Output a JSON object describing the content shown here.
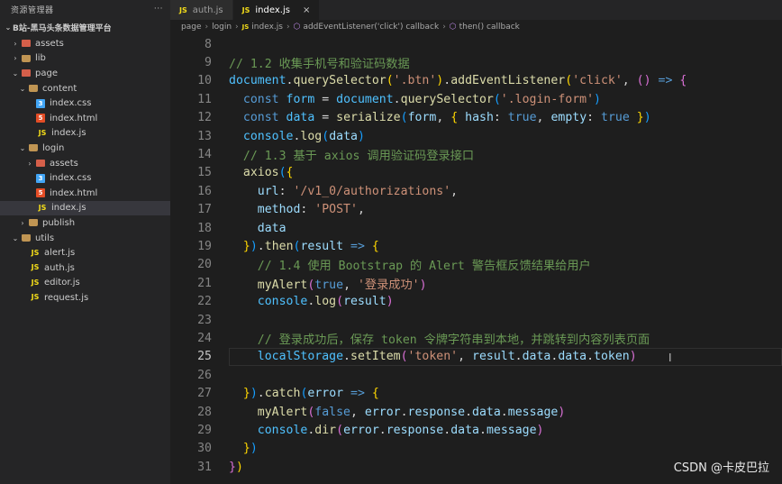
{
  "sidebar": {
    "header": "资源管理器",
    "root": "B站-黑马头条数据管理平台",
    "items": [
      {
        "label": "assets",
        "depth": 1,
        "kind": "folder-red",
        "chev": "›"
      },
      {
        "label": "lib",
        "depth": 1,
        "kind": "folder",
        "chev": "›"
      },
      {
        "label": "page",
        "depth": 1,
        "kind": "folder-red",
        "chev": "⌄"
      },
      {
        "label": "content",
        "depth": 2,
        "kind": "folder",
        "chev": "⌄"
      },
      {
        "label": "index.css",
        "depth": 3,
        "kind": "css",
        "chev": ""
      },
      {
        "label": "index.html",
        "depth": 3,
        "kind": "html",
        "chev": ""
      },
      {
        "label": "index.js",
        "depth": 3,
        "kind": "js",
        "chev": ""
      },
      {
        "label": "login",
        "depth": 2,
        "kind": "folder",
        "chev": "⌄"
      },
      {
        "label": "assets",
        "depth": 3,
        "kind": "folder-red",
        "chev": "›"
      },
      {
        "label": "index.css",
        "depth": 3,
        "kind": "css",
        "chev": ""
      },
      {
        "label": "index.html",
        "depth": 3,
        "kind": "html",
        "chev": ""
      },
      {
        "label": "index.js",
        "depth": 3,
        "kind": "js",
        "chev": "",
        "selected": true
      },
      {
        "label": "publish",
        "depth": 2,
        "kind": "folder",
        "chev": "›"
      },
      {
        "label": "utils",
        "depth": 1,
        "kind": "folder",
        "chev": "⌄"
      },
      {
        "label": "alert.js",
        "depth": 2,
        "kind": "js",
        "chev": ""
      },
      {
        "label": "auth.js",
        "depth": 2,
        "kind": "js",
        "chev": ""
      },
      {
        "label": "editor.js",
        "depth": 2,
        "kind": "js",
        "chev": ""
      },
      {
        "label": "request.js",
        "depth": 2,
        "kind": "js",
        "chev": ""
      }
    ],
    "more": "···"
  },
  "tabs": [
    {
      "label": "auth.js",
      "active": false,
      "icon": "JS"
    },
    {
      "label": "index.js",
      "active": true,
      "icon": "JS",
      "close": "×"
    }
  ],
  "breadcrumb": {
    "parts": [
      "page",
      "login",
      "index.js",
      "addEventListener('click') callback",
      "then() callback"
    ]
  },
  "editor": {
    "current_line": 25,
    "lines": [
      {
        "n": 8,
        "t": []
      },
      {
        "n": 9,
        "t": [
          [
            "cm",
            "// 1.2 收集手机号和验证码数据"
          ]
        ]
      },
      {
        "n": 10,
        "t": [
          [
            "var",
            "document"
          ],
          [
            "pun",
            "."
          ],
          [
            "fn",
            "querySelector"
          ],
          [
            "br1",
            "("
          ],
          [
            "str",
            "'.btn'"
          ],
          [
            "br1",
            ")"
          ],
          [
            "pun",
            "."
          ],
          [
            "fn",
            "addEventListener"
          ],
          [
            "br1",
            "("
          ],
          [
            "str",
            "'click'"
          ],
          [
            "pun",
            ", "
          ],
          [
            "br2",
            "()"
          ],
          [
            "kw",
            " =>"
          ],
          [
            "pun",
            " "
          ],
          [
            "br2",
            "{"
          ]
        ]
      },
      {
        "n": 11,
        "t": [
          [
            "pun",
            "  "
          ],
          [
            "kw",
            "const"
          ],
          [
            "pun",
            " "
          ],
          [
            "var",
            "form"
          ],
          [
            "pun",
            " = "
          ],
          [
            "var",
            "document"
          ],
          [
            "pun",
            "."
          ],
          [
            "fn",
            "querySelector"
          ],
          [
            "br3",
            "("
          ],
          [
            "str",
            "'.login-form'"
          ],
          [
            "br3",
            ")"
          ]
        ]
      },
      {
        "n": 12,
        "t": [
          [
            "pun",
            "  "
          ],
          [
            "kw",
            "const"
          ],
          [
            "pun",
            " "
          ],
          [
            "var",
            "data"
          ],
          [
            "pun",
            " = "
          ],
          [
            "fn",
            "serialize"
          ],
          [
            "br3",
            "("
          ],
          [
            "prop",
            "form"
          ],
          [
            "pun",
            ", "
          ],
          [
            "br1",
            "{"
          ],
          [
            "pun",
            " "
          ],
          [
            "prop",
            "hash"
          ],
          [
            "pun",
            ": "
          ],
          [
            "kw",
            "true"
          ],
          [
            "pun",
            ", "
          ],
          [
            "prop",
            "empty"
          ],
          [
            "pun",
            ": "
          ],
          [
            "kw",
            "true"
          ],
          [
            "pun",
            " "
          ],
          [
            "br1",
            "}"
          ],
          [
            "br3",
            ")"
          ]
        ]
      },
      {
        "n": 13,
        "t": [
          [
            "pun",
            "  "
          ],
          [
            "var",
            "console"
          ],
          [
            "pun",
            "."
          ],
          [
            "fn",
            "log"
          ],
          [
            "br3",
            "("
          ],
          [
            "prop",
            "data"
          ],
          [
            "br3",
            ")"
          ]
        ]
      },
      {
        "n": 14,
        "t": [
          [
            "pun",
            "  "
          ],
          [
            "cm",
            "// 1.3 基于 axios 调用验证码登录接口"
          ]
        ]
      },
      {
        "n": 15,
        "t": [
          [
            "pun",
            "  "
          ],
          [
            "fn",
            "axios"
          ],
          [
            "br3",
            "("
          ],
          [
            "br1",
            "{"
          ]
        ]
      },
      {
        "n": 16,
        "t": [
          [
            "pun",
            "    "
          ],
          [
            "prop",
            "url"
          ],
          [
            "pun",
            ": "
          ],
          [
            "str",
            "'/v1_0/authorizations'"
          ],
          [
            "pun",
            ","
          ]
        ]
      },
      {
        "n": 17,
        "t": [
          [
            "pun",
            "    "
          ],
          [
            "prop",
            "method"
          ],
          [
            "pun",
            ": "
          ],
          [
            "str",
            "'POST'"
          ],
          [
            "pun",
            ","
          ]
        ]
      },
      {
        "n": 18,
        "t": [
          [
            "pun",
            "    "
          ],
          [
            "prop",
            "data"
          ]
        ]
      },
      {
        "n": 19,
        "t": [
          [
            "pun",
            "  "
          ],
          [
            "br1",
            "}"
          ],
          [
            "br3",
            ")"
          ],
          [
            "pun",
            "."
          ],
          [
            "fn",
            "then"
          ],
          [
            "br3",
            "("
          ],
          [
            "prop",
            "result"
          ],
          [
            "kw",
            " =>"
          ],
          [
            "pun",
            " "
          ],
          [
            "br1",
            "{"
          ]
        ]
      },
      {
        "n": 20,
        "t": [
          [
            "pun",
            "    "
          ],
          [
            "cm",
            "// 1.4 使用 Bootstrap 的 Alert 警告框反馈结果给用户"
          ]
        ]
      },
      {
        "n": 21,
        "t": [
          [
            "pun",
            "    "
          ],
          [
            "fn",
            "myAlert"
          ],
          [
            "br2",
            "("
          ],
          [
            "kw",
            "true"
          ],
          [
            "pun",
            ", "
          ],
          [
            "str",
            "'登录成功'"
          ],
          [
            "br2",
            ")"
          ]
        ]
      },
      {
        "n": 22,
        "t": [
          [
            "pun",
            "    "
          ],
          [
            "var",
            "console"
          ],
          [
            "pun",
            "."
          ],
          [
            "fn",
            "log"
          ],
          [
            "br2",
            "("
          ],
          [
            "prop",
            "result"
          ],
          [
            "br2",
            ")"
          ]
        ]
      },
      {
        "n": 23,
        "t": []
      },
      {
        "n": 24,
        "t": [
          [
            "pun",
            "    "
          ],
          [
            "cm",
            "// 登录成功后，保存 token 令牌字符串到本地，并跳转到内容列表页面"
          ]
        ]
      },
      {
        "n": 25,
        "t": [
          [
            "pun",
            "    "
          ],
          [
            "var",
            "localStorage"
          ],
          [
            "pun",
            "."
          ],
          [
            "fn",
            "setItem"
          ],
          [
            "br2",
            "("
          ],
          [
            "str",
            "'token'"
          ],
          [
            "pun",
            ", "
          ],
          [
            "prop",
            "result"
          ],
          [
            "pun",
            "."
          ],
          [
            "prop",
            "data"
          ],
          [
            "pun",
            "."
          ],
          [
            "prop",
            "data"
          ],
          [
            "pun",
            "."
          ],
          [
            "prop",
            "token"
          ],
          [
            "br2",
            ")"
          ]
        ]
      },
      {
        "n": 26,
        "t": []
      },
      {
        "n": 27,
        "t": [
          [
            "pun",
            "  "
          ],
          [
            "br1",
            "}"
          ],
          [
            "br3",
            ")"
          ],
          [
            "pun",
            "."
          ],
          [
            "fn",
            "catch"
          ],
          [
            "br3",
            "("
          ],
          [
            "prop",
            "error"
          ],
          [
            "kw",
            " =>"
          ],
          [
            "pun",
            " "
          ],
          [
            "br1",
            "{"
          ]
        ]
      },
      {
        "n": 28,
        "t": [
          [
            "pun",
            "    "
          ],
          [
            "fn",
            "myAlert"
          ],
          [
            "br2",
            "("
          ],
          [
            "kw",
            "false"
          ],
          [
            "pun",
            ", "
          ],
          [
            "prop",
            "error"
          ],
          [
            "pun",
            "."
          ],
          [
            "prop",
            "response"
          ],
          [
            "pun",
            "."
          ],
          [
            "prop",
            "data"
          ],
          [
            "pun",
            "."
          ],
          [
            "prop",
            "message"
          ],
          [
            "br2",
            ")"
          ]
        ]
      },
      {
        "n": 29,
        "t": [
          [
            "pun",
            "    "
          ],
          [
            "var",
            "console"
          ],
          [
            "pun",
            "."
          ],
          [
            "fn",
            "dir"
          ],
          [
            "br2",
            "("
          ],
          [
            "prop",
            "error"
          ],
          [
            "pun",
            "."
          ],
          [
            "prop",
            "response"
          ],
          [
            "pun",
            "."
          ],
          [
            "prop",
            "data"
          ],
          [
            "pun",
            "."
          ],
          [
            "prop",
            "message"
          ],
          [
            "br2",
            ")"
          ]
        ]
      },
      {
        "n": 30,
        "t": [
          [
            "pun",
            "  "
          ],
          [
            "br1",
            "}"
          ],
          [
            "br3",
            ")"
          ]
        ]
      },
      {
        "n": 31,
        "t": [
          [
            "br2",
            "}"
          ],
          [
            "br1",
            ")"
          ]
        ]
      }
    ]
  },
  "watermark": "CSDN @卡皮巴拉"
}
